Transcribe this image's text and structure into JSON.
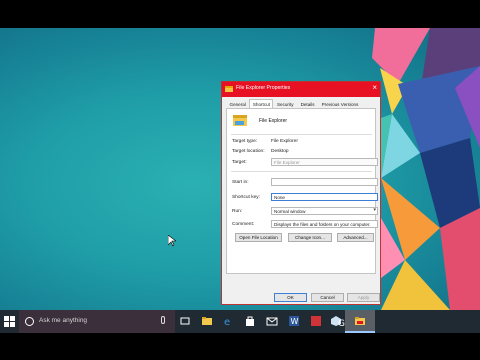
{
  "dialog": {
    "title": "File Explorer Properties",
    "tabs": [
      {
        "label": "General"
      },
      {
        "label": "Shortcut",
        "active": true
      },
      {
        "label": "Security"
      },
      {
        "label": "Details"
      },
      {
        "label": "Previous Versions"
      }
    ],
    "app_name": "File Explorer",
    "fields": {
      "target_type_label": "Target type:",
      "target_type_value": "File Explorer",
      "target_location_label": "Target location:",
      "target_location_value": "Desktop",
      "target_label": "Target:",
      "target_value": "File Explorer",
      "start_in_label": "Start in:",
      "start_in_value": "",
      "shortcut_key_label": "Shortcut key:",
      "shortcut_key_value": "None",
      "run_label": "Run:",
      "run_value": "Normal window",
      "comment_label": "Comment:",
      "comment_value": "Displays the files and folders on your computer."
    },
    "buttons": {
      "open_file_location": "Open File Location",
      "change_icon": "Change Icon...",
      "advanced": "Advanced...",
      "ok": "OK",
      "cancel": "Cancel",
      "apply": "Apply"
    }
  },
  "taskbar": {
    "search_placeholder": "Ask me anything",
    "icons": [
      "task-view-icon",
      "file-explorer-icon",
      "edge-icon",
      "store-icon",
      "mail-icon",
      "word-icon",
      "red-app-icon",
      "cube-app-icon",
      "green-app-icon",
      "file-explorer-properties-icon"
    ]
  },
  "colors": {
    "titlebar": "#e81123",
    "desktop": "#1f9ea8",
    "taskbar": "#1f2a33"
  }
}
